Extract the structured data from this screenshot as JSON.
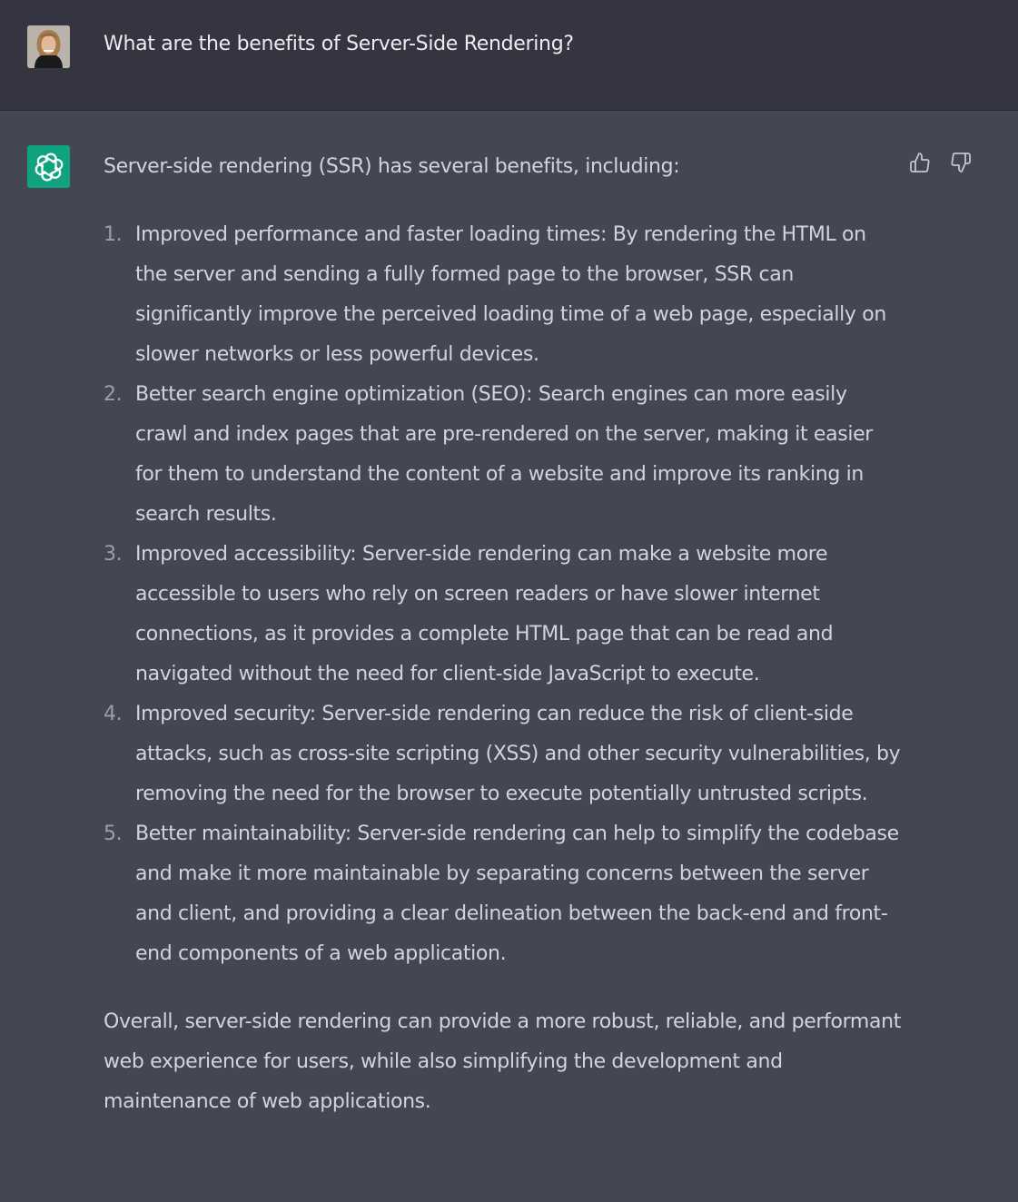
{
  "user_message": {
    "text": "What are the benefits of Server-Side Rendering?",
    "avatar": "user-avatar-photo"
  },
  "assistant_message": {
    "avatar_icon": "openai-logo-icon",
    "intro": "Server-side rendering (SSR) has several benefits, including:",
    "items": [
      {
        "number": "1.",
        "text": "Improved performance and faster loading times: By rendering the HTML on the server and sending a fully formed page to the browser, SSR can significantly improve the perceived loading time of a web page, especially on slower networks or less powerful devices."
      },
      {
        "number": "2.",
        "text": "Better search engine optimization (SEO): Search engines can more easily crawl and index pages that are pre-rendered on the server, making it easier for them to understand the content of a website and improve its ranking in search results."
      },
      {
        "number": "3.",
        "text": "Improved accessibility: Server-side rendering can make a website more accessible to users who rely on screen readers or have slower internet connections, as it provides a complete HTML page that can be read and navigated without the need for client-side JavaScript to execute."
      },
      {
        "number": "4.",
        "text": "Improved security: Server-side rendering can reduce the risk of client-side attacks, such as cross-site scripting (XSS) and other security vulnerabilities, by removing the need for the browser to execute potentially untrusted scripts."
      },
      {
        "number": "5.",
        "text": "Better maintainability: Server-side rendering can help to simplify the codebase and make it more maintainable by separating concerns between the server and client, and providing a clear delineation between the back-end and front-end components of a web application."
      }
    ],
    "outro": "Overall, server-side rendering can provide a more robust, reliable, and performant web experience for users, while also simplifying the development and maintenance of web applications."
  },
  "feedback": {
    "thumbs_up_icon": "thumbs-up-icon",
    "thumbs_down_icon": "thumbs-down-icon"
  },
  "colors": {
    "user_bg": "#343541",
    "assistant_bg": "#444654",
    "brand_green": "#10a37f",
    "text": "#d1d5db"
  }
}
